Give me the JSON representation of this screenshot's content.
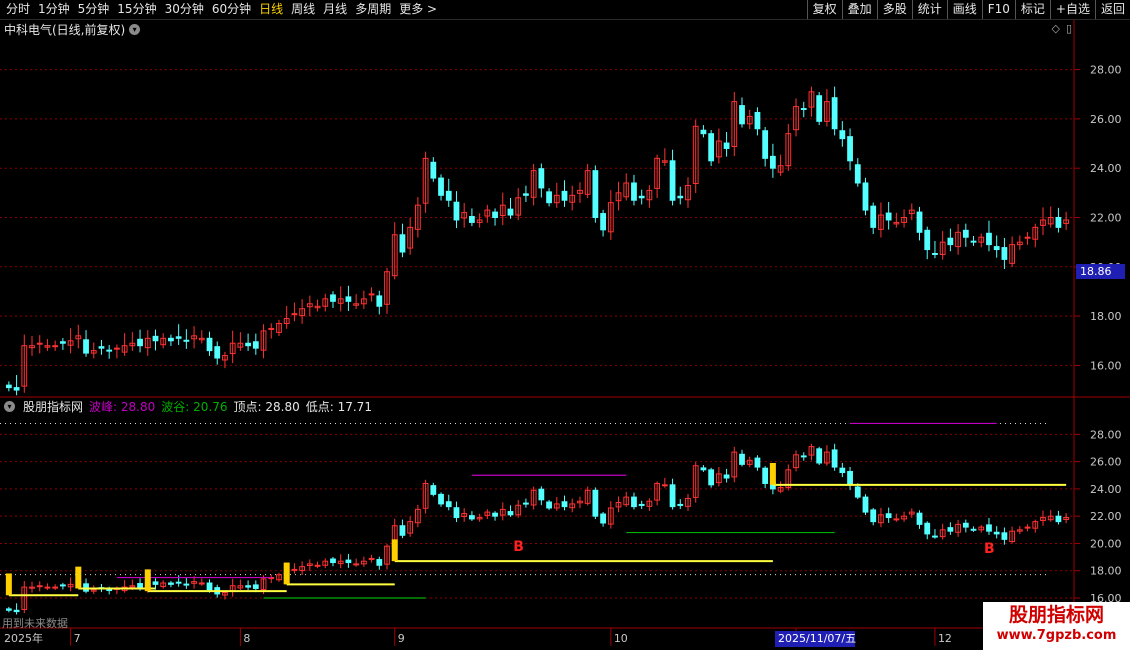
{
  "toolbar": {
    "periods": [
      "分时",
      "1分钟",
      "5分钟",
      "15分钟",
      "30分钟",
      "60分钟",
      "日线",
      "周线",
      "月线",
      "多周期",
      "更多 >"
    ],
    "active_index": 6,
    "buttons": [
      "复权",
      "叠加",
      "多股",
      "统计",
      "画线",
      "F10",
      "标记",
      "+自选",
      "返回"
    ]
  },
  "main_chart": {
    "title": "中科电气(日线,前复权)",
    "y_ticks": [
      "28.00",
      "26.00",
      "24.00",
      "22.00",
      "20.00",
      "18.00",
      "16.00"
    ],
    "current_price": "18.86"
  },
  "indicator": {
    "name": "股朋指标网",
    "peak_label": "波峰:",
    "peak_value": "28.80",
    "valley_label": "波谷:",
    "valley_value": "20.76",
    "top_label": "顶点:",
    "top_value": "28.80",
    "low_label": "低点:",
    "low_value": "17.71",
    "y_ticks": [
      "28.00",
      "26.00",
      "24.00",
      "22.00",
      "20.00",
      "18.00",
      "16.00"
    ],
    "markers": [
      "B",
      "B"
    ],
    "future_text": "用到未来数据"
  },
  "x_axis": {
    "labels": [
      "2025年",
      "7",
      "8",
      "9",
      "10",
      "11",
      "12"
    ],
    "highlight": "2025/11/07/五"
  },
  "watermark": {
    "line1": "股朋指标网",
    "line2": "www.7gpzb.com"
  },
  "colors": {
    "up": "#ff3232",
    "down": "#54ffff",
    "grid": "#8b0000",
    "peak": "#c000c0",
    "valley": "#00b000",
    "line_yellow": "#ffff40"
  },
  "chart_data": {
    "type": "candlestick",
    "closes": [
      15.1,
      15.0,
      16.8,
      16.8,
      16.9,
      16.8,
      16.8,
      16.9,
      17.0,
      17.2,
      16.5,
      16.6,
      16.7,
      16.6,
      16.7,
      16.8,
      16.9,
      16.8,
      17.1,
      17.0,
      17.1,
      17.0,
      17.1,
      17.0,
      17.2,
      17.1,
      16.6,
      16.3,
      16.4,
      16.9,
      16.9,
      16.8,
      16.7,
      17.4,
      17.5,
      17.7,
      17.9,
      18.1,
      18.3,
      18.5,
      18.4,
      18.7,
      18.6,
      18.7,
      18.6,
      18.5,
      18.7,
      18.9,
      18.4,
      19.8,
      21.3,
      20.6,
      21.6,
      22.5,
      24.4,
      23.6,
      22.9,
      22.7,
      21.9,
      22.2,
      21.8,
      21.9,
      22.3,
      22.0,
      22.5,
      22.1,
      22.8,
      22.9,
      23.9,
      23.2,
      22.6,
      22.9,
      22.7,
      22.9,
      23.1,
      23.9,
      22.0,
      21.5,
      22.6,
      23.0,
      23.4,
      22.7,
      22.8,
      23.1,
      24.4,
      24.3,
      22.7,
      22.8,
      23.3,
      25.7,
      25.4,
      24.3,
      25.1,
      24.8,
      26.7,
      25.8,
      26.1,
      25.6,
      24.4,
      24.0,
      24.1,
      25.4,
      26.5,
      26.4,
      27.1,
      25.9,
      26.7,
      25.6,
      25.2,
      24.3,
      23.4,
      22.3,
      21.6,
      22.1,
      21.9,
      21.8,
      22.0,
      22.3,
      21.4,
      20.7,
      20.5,
      21.0,
      20.9,
      21.4,
      21.2,
      21.0,
      21.2,
      20.9,
      20.7,
      20.3,
      20.9,
      21.0,
      21.2,
      21.6,
      21.9,
      22.0,
      21.6,
      21.9
    ],
    "y_range_main": [
      14.8,
      29.2
    ],
    "y_range_indicator": [
      16.0,
      29.2
    ],
    "peak_segments": [
      [
        14,
        34,
        17.5
      ],
      [
        60,
        80,
        25.0
      ],
      [
        109,
        128,
        28.8
      ]
    ],
    "valley_segments": [
      [
        33,
        54,
        16.0
      ],
      [
        80,
        107,
        20.8
      ]
    ],
    "yellow_segments": [
      [
        0,
        9,
        16.2
      ],
      [
        9,
        19,
        16.7
      ],
      [
        18,
        36,
        16.5
      ],
      [
        36,
        50,
        17.0
      ],
      [
        50,
        99,
        18.7
      ],
      [
        99,
        137,
        24.3
      ]
    ],
    "b_markers": [
      66,
      127
    ],
    "x_labels_at": [
      0,
      8,
      30,
      50,
      78,
      102,
      120
    ]
  }
}
